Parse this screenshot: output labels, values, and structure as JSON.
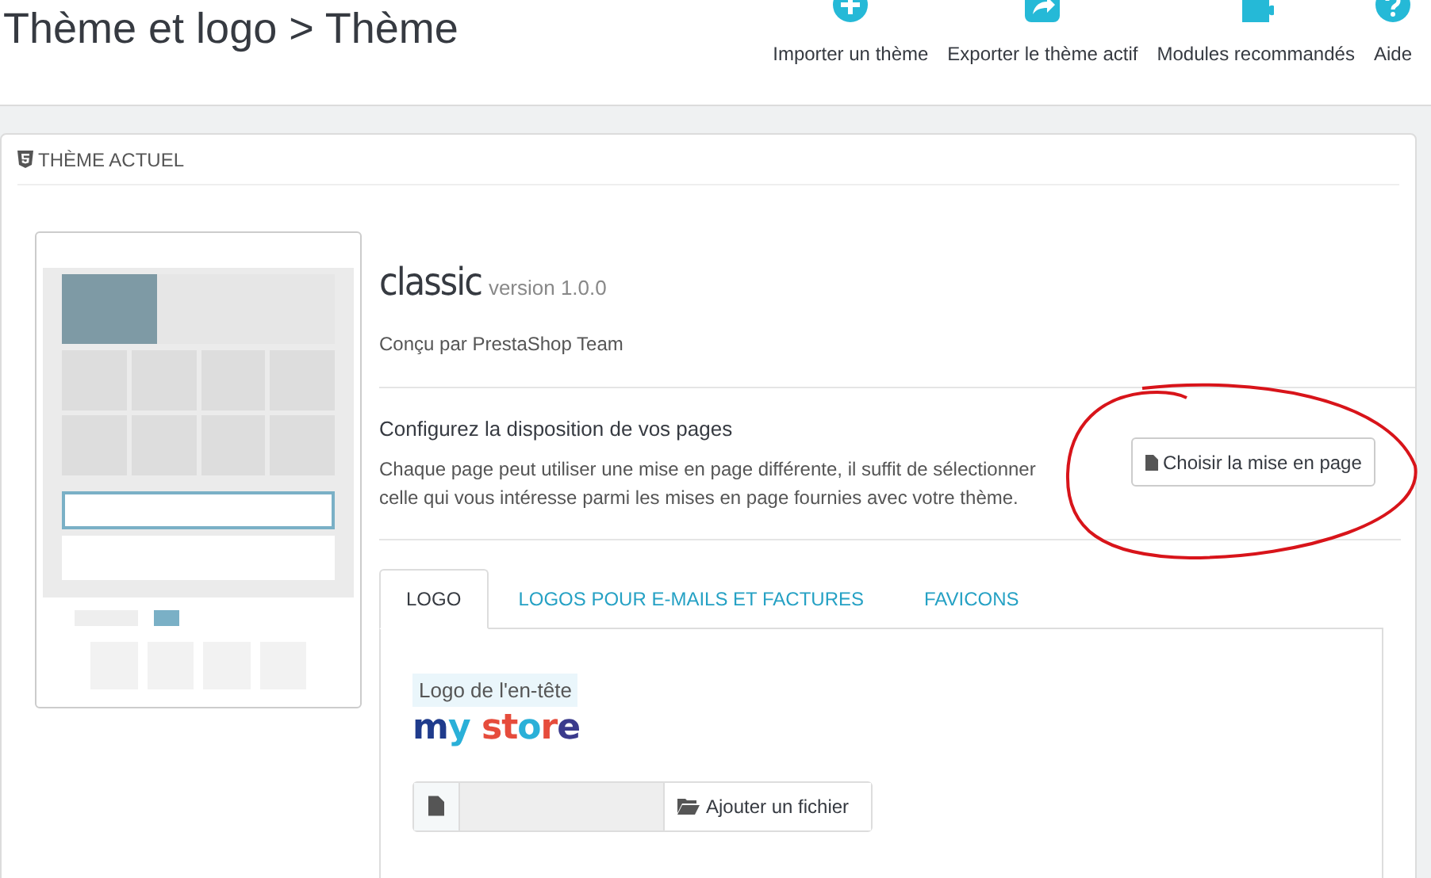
{
  "page_title": "Thème et logo > Thème",
  "toolbar": [
    {
      "label": "Importer un thème",
      "kind": "plus"
    },
    {
      "label": "Exporter le thème actif",
      "kind": "share"
    },
    {
      "label": "Modules recommandés",
      "kind": "puzzle"
    },
    {
      "label": "Aide",
      "kind": "help"
    }
  ],
  "panel": {
    "title": "THÈME ACTUEL",
    "theme": {
      "name": "classic",
      "version": "version 1.0.0",
      "author": "Conçu par PrestaShop Team"
    },
    "layout_section": {
      "heading": "Configurez la disposition de vos pages",
      "description": "Chaque page peut utiliser une mise en page différente, il suffit de sélectionner celle qui vous intéresse parmi les mises en page fournies avec votre thème.",
      "button": "Choisir la mise en page"
    },
    "tabs": [
      {
        "label": "LOGO",
        "selected": true
      },
      {
        "label": "LOGOS POUR E-MAILS ET FACTURES",
        "selected": false
      },
      {
        "label": "FAVICONS",
        "selected": false
      }
    ],
    "logo": {
      "label": "Logo de l'en-tête",
      "logo_text": "my store",
      "upload_button": "Ajouter un fichier"
    }
  }
}
